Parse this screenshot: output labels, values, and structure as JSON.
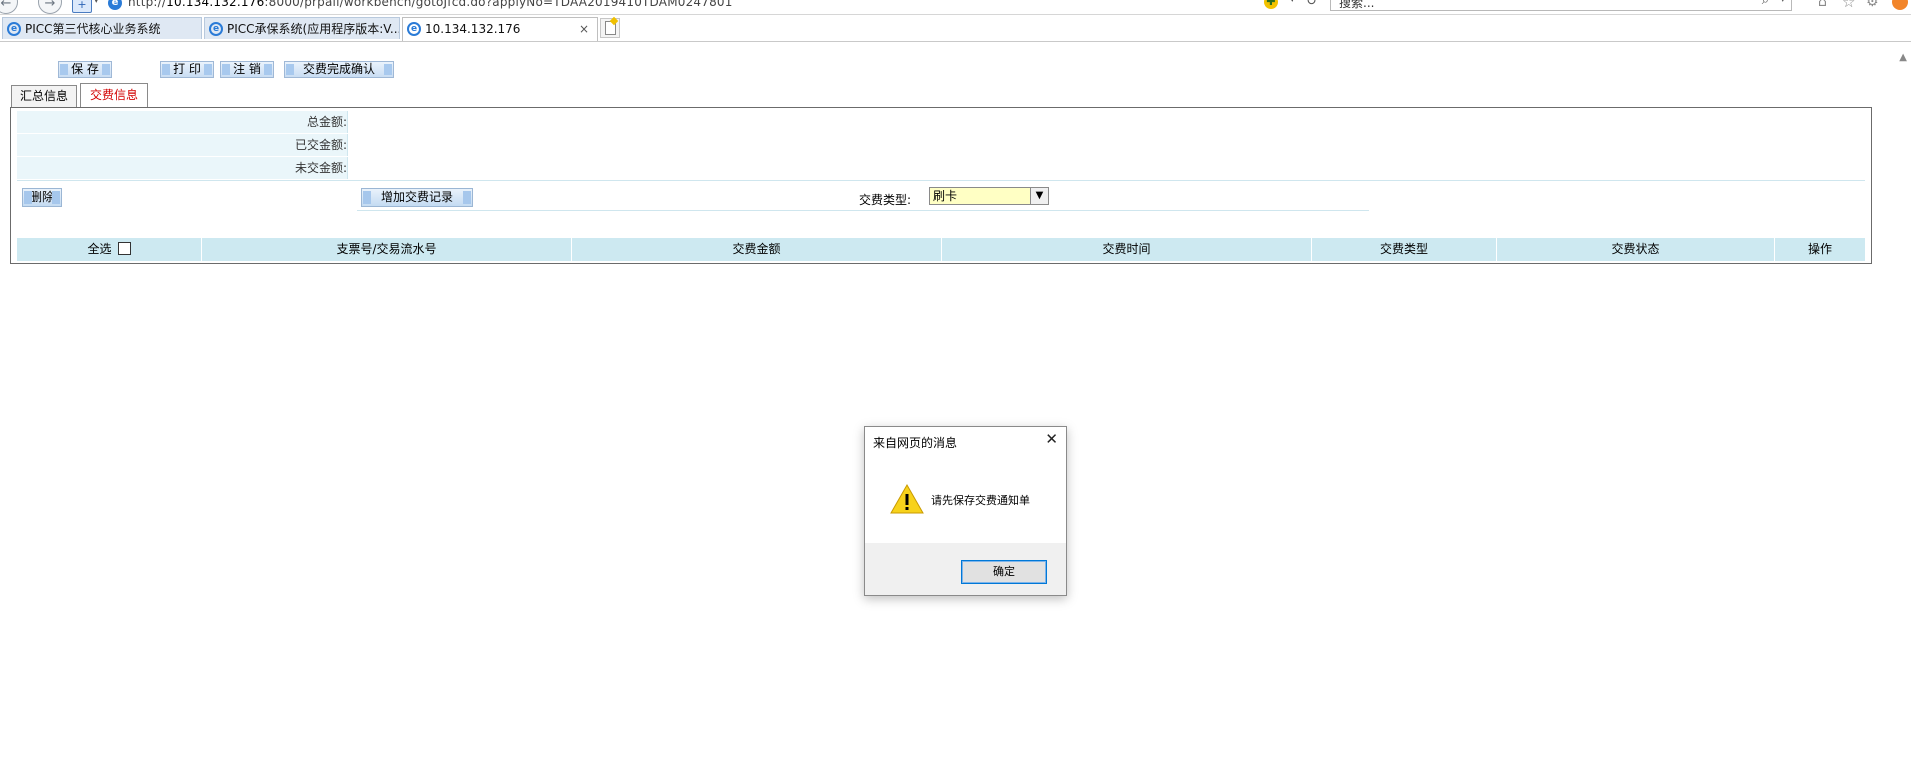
{
  "browser": {
    "url_prefix": "http://",
    "url_host": "10.134.132.176",
    "url_rest": ":8000/prpall/workbench/gotoJfcd.do?applyNo=TDAA2019410TDAM0247801",
    "search_placeholder": "搜索...",
    "tabs": [
      {
        "label": "PICC第三代核心业务系统"
      },
      {
        "label": "PICC承保系统(应用程序版本:V..."
      },
      {
        "label": "10.134.132.176"
      }
    ],
    "close_glyph": "×"
  },
  "toolbar": {
    "save": "保 存",
    "print": "打 印",
    "logout": "注 销",
    "confirm": "交费完成确认"
  },
  "page_tabs": {
    "summary": "汇总信息",
    "payment": "交费信息"
  },
  "summary": {
    "total_label": "总金额:",
    "paid_label": "已交金额:",
    "unpaid_label": "未交金额:",
    "total_value": "",
    "paid_value": "",
    "unpaid_value": ""
  },
  "actions": {
    "delete": "删除",
    "add_record": "增加交费记录",
    "pay_type_label": "交费类型:",
    "pay_type_value": "刷卡"
  },
  "grid": {
    "columns": [
      "全选",
      "支票号/交易流水号",
      "交费金额",
      "交费时间",
      "交费类型",
      "交费状态",
      "操作"
    ]
  },
  "dialog": {
    "title": "来自网页的消息",
    "message": "请先保存交费通知单",
    "ok": "确定"
  }
}
